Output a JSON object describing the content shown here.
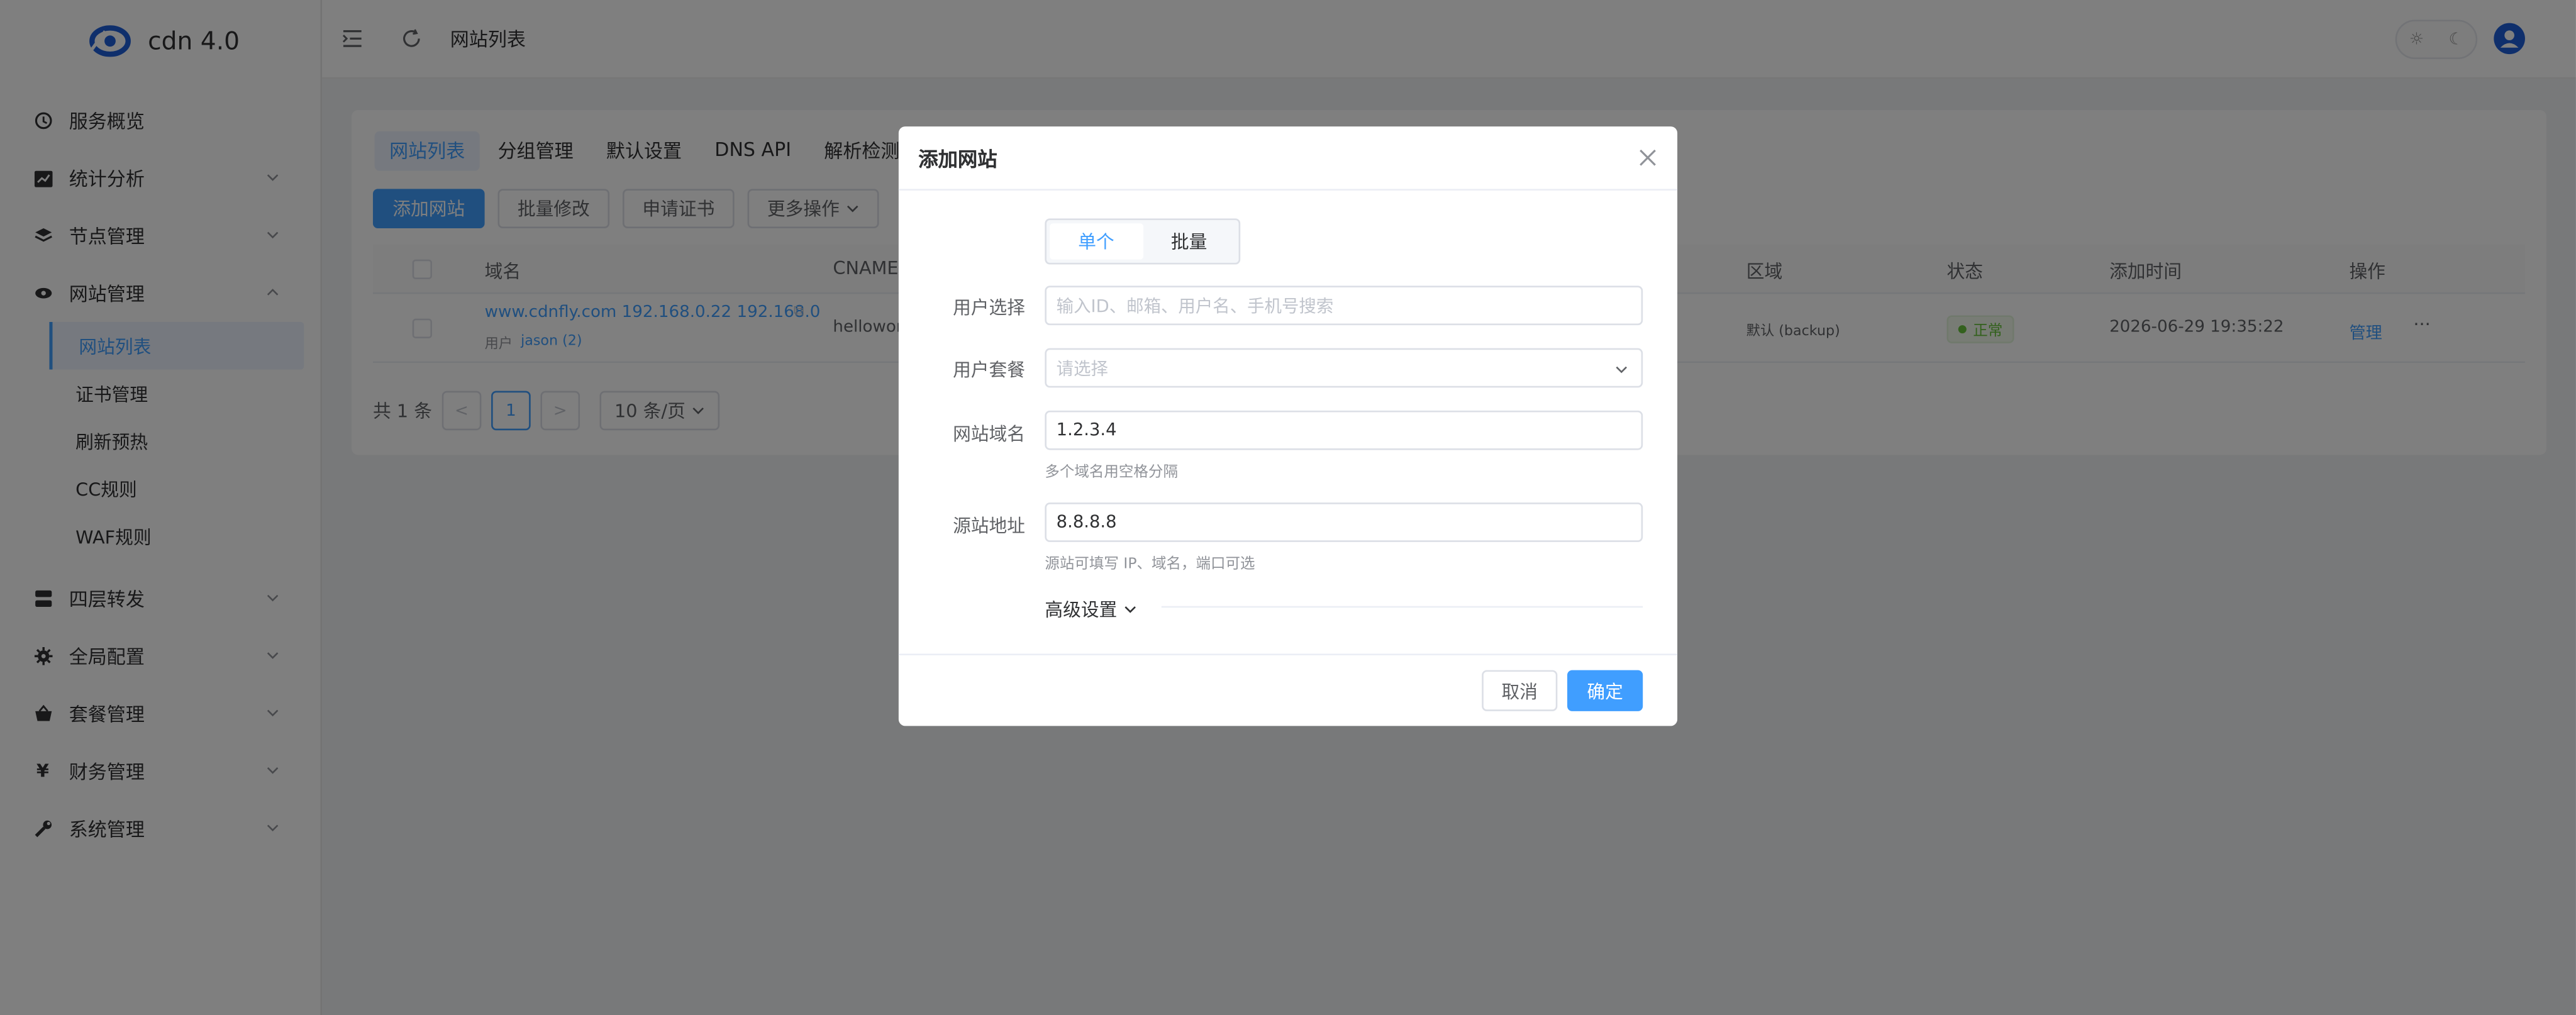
{
  "brand": {
    "name": "cdn 4.0",
    "accent": "#409eff"
  },
  "header": {
    "title": "网站列表"
  },
  "sidebar": {
    "items": [
      {
        "label": "服务概览",
        "icon": "dashboard-icon"
      },
      {
        "label": "统计分析",
        "icon": "chart-icon"
      },
      {
        "label": "节点管理",
        "icon": "layers-icon"
      },
      {
        "label": "网站管理",
        "icon": "globe-icon"
      },
      {
        "label": "四层转发",
        "icon": "server-icon"
      },
      {
        "label": "全局配置",
        "icon": "gear-icon"
      },
      {
        "label": "套餐管理",
        "icon": "basket-icon"
      },
      {
        "label": "财务管理",
        "icon": "yen-icon"
      },
      {
        "label": "系统管理",
        "icon": "wrench-icon"
      }
    ],
    "website_sub": [
      "网站列表",
      "证书管理",
      "刷新预热",
      "CC规则",
      "WAF规则"
    ]
  },
  "tabs": [
    "网站列表",
    "分组管理",
    "默认设置",
    "DNS API",
    "解析检测"
  ],
  "toolbar": {
    "add": "添加网站",
    "batch_edit": "批量修改",
    "apply_cert": "申请证书",
    "more": "更多操作"
  },
  "table": {
    "headers": {
      "domain": "域名",
      "cname": "CNAME",
      "region": "区域",
      "status": "状态",
      "added": "添加时间",
      "actions": "操作"
    },
    "rows": [
      {
        "domain": "www.cdnfly.com 192.168.0.22 192.168.0",
        "user_label": "用户",
        "user": "jason (2)",
        "cname": "hellowor",
        "region": "默认 (backup)",
        "status": "正常",
        "added": "2026-06-29 19:35:22",
        "manage": "管理",
        "more": "···"
      }
    ]
  },
  "pager": {
    "total": "共 1 条",
    "prev": "<",
    "page": "1",
    "next": ">",
    "size": "10 条/页"
  },
  "dialog": {
    "title": "添加网站",
    "modes": [
      "单个",
      "批量"
    ],
    "fields": {
      "user_label": "用户选择",
      "user_placeholder": "输入ID、邮箱、用户名、手机号搜索",
      "plan_label": "用户套餐",
      "plan_placeholder": "请选择",
      "domain_label": "网站域名",
      "domain_value": "1.2.3.4",
      "domain_hint": "多个域名用空格分隔",
      "origin_label": "源站地址",
      "origin_value": "8.8.8.8",
      "origin_hint": "源站可填写 IP、域名，端口可选"
    },
    "advanced": "高级设置",
    "cancel": "取消",
    "ok": "确定"
  }
}
